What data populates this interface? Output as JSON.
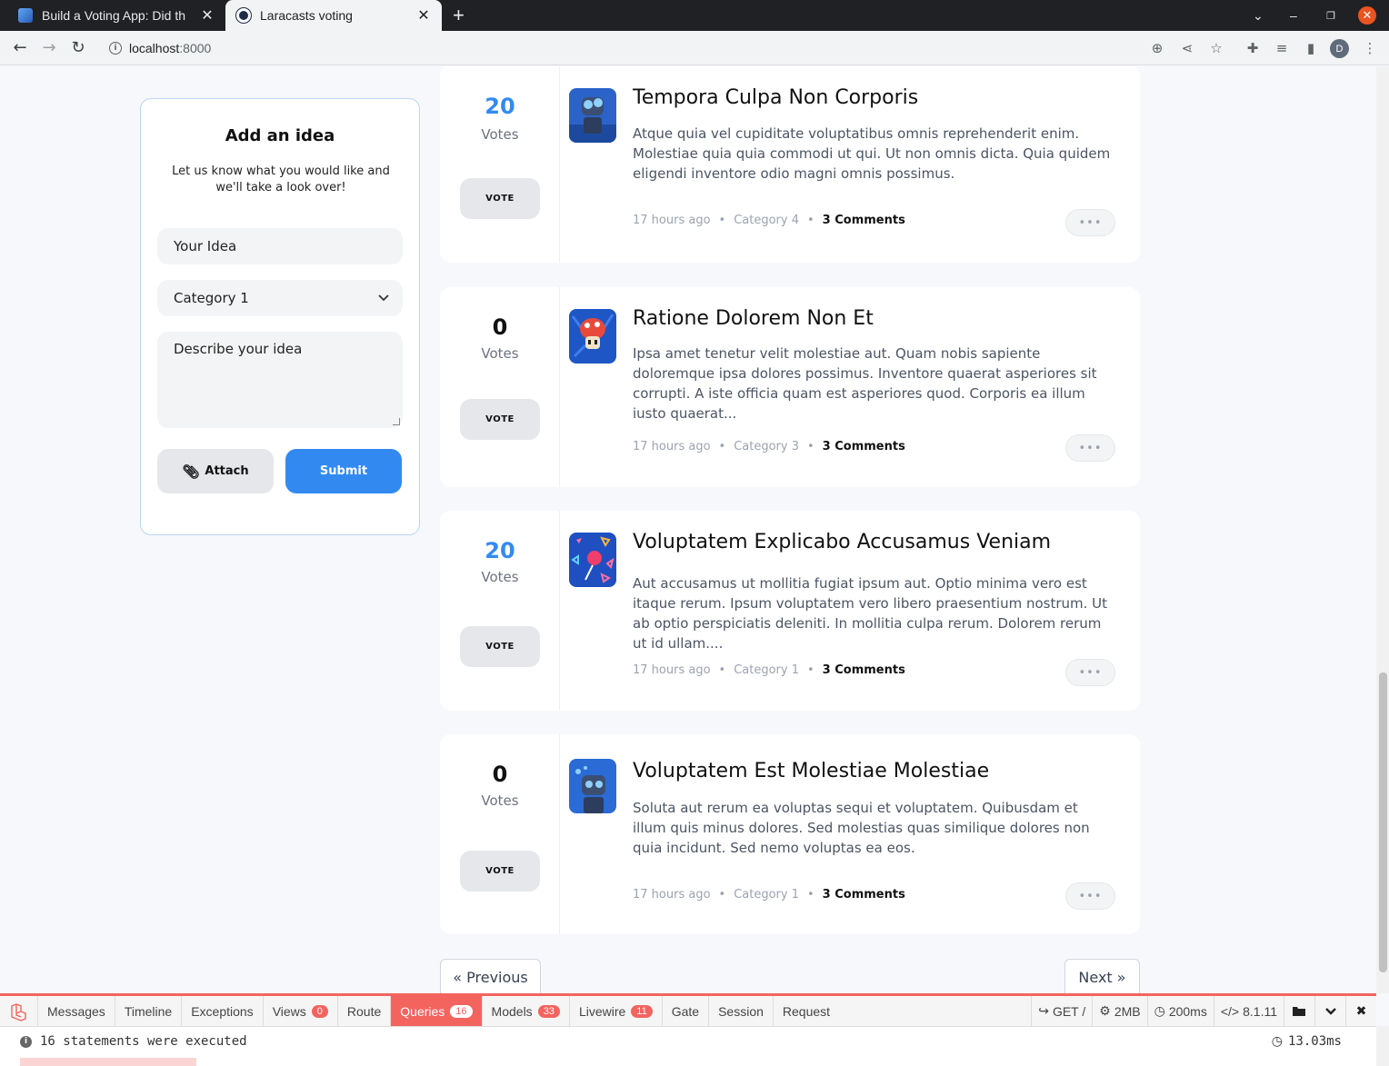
{
  "browser": {
    "tabs": [
      {
        "title": "Build a Voting App: Did th",
        "active": false
      },
      {
        "title": "Laracasts voting",
        "active": true
      }
    ],
    "url_host": "localhost",
    "url_port": ":8000",
    "profile_initial": "D"
  },
  "add_idea": {
    "title": "Add an idea",
    "subtitle": "Let us know what you would like and we'll take a look over!",
    "idea_placeholder": "Your Idea",
    "category_value": "Category 1",
    "description_placeholder": "Describe your idea",
    "attach_label": "Attach",
    "submit_label": "Submit"
  },
  "ideas": [
    {
      "votes": "20",
      "votes_label": "Votes",
      "vote_button": "VOTE",
      "title": "Tempora Culpa Non Corporis",
      "description": "Atque quia vel cupiditate voluptatibus omnis reprehenderit enim. Molestiae quia quia commodi ut qui. Ut non omnis dicta. Quia quidem eligendi inventore odio magni omnis possimus.",
      "time": "17 hours ago",
      "category": "Category 4",
      "comments": "3 Comments",
      "more": "•••"
    },
    {
      "votes": "0",
      "votes_label": "Votes",
      "vote_button": "VOTE",
      "title": "Ratione Dolorem Non Et",
      "description": "Ipsa amet tenetur velit molestiae aut. Quam nobis sapiente doloremque ipsa dolores possimus. Inventore quaerat asperiores sit corrupti. A iste officia quam est asperiores quod. Corporis ea illum iusto quaerat...",
      "time": "17 hours ago",
      "category": "Category 3",
      "comments": "3 Comments",
      "more": "•••"
    },
    {
      "votes": "20",
      "votes_label": "Votes",
      "vote_button": "VOTE",
      "title": "Voluptatem Explicabo Accusamus Veniam",
      "description": "Aut accusamus ut mollitia fugiat ipsum aut. Optio minima vero est itaque rerum. Ipsum voluptatem vero libero praesentium nostrum. Ut ab optio perspiciatis deleniti. In mollitia culpa rerum. Dolorem rerum ut id ullam....",
      "time": "17 hours ago",
      "category": "Category 1",
      "comments": "3 Comments",
      "more": "•••"
    },
    {
      "votes": "0",
      "votes_label": "Votes",
      "vote_button": "VOTE",
      "title": "Voluptatem Est Molestiae Molestiae",
      "description": "Soluta aut rerum ea voluptas sequi et voluptatem. Quibusdam et illum quis minus dolores. Sed molestias quas similique dolores non quia incidunt. Sed nemo voluptas ea eos.",
      "time": "17 hours ago",
      "category": "Category 1",
      "comments": "3 Comments",
      "more": "•••"
    }
  ],
  "pagination": {
    "previous": "« Previous",
    "next": "Next »"
  },
  "debugbar": {
    "tabs": {
      "messages": "Messages",
      "timeline": "Timeline",
      "exceptions": "Exceptions",
      "views": "Views",
      "views_count": "0",
      "route": "Route",
      "queries": "Queries",
      "queries_count": "16",
      "models": "Models",
      "models_count": "33",
      "livewire": "Livewire",
      "livewire_count": "11",
      "gate": "Gate",
      "session": "Session",
      "request": "Request"
    },
    "indicators": {
      "method": "GET /",
      "memory": "2MB",
      "time": "200ms",
      "php": "8.1.11"
    },
    "panel": {
      "summary": "16 statements were executed",
      "duration": "13.03ms"
    }
  },
  "colors": {
    "accent_blue": "#328af1",
    "debugbar_red": "#f4645f"
  }
}
